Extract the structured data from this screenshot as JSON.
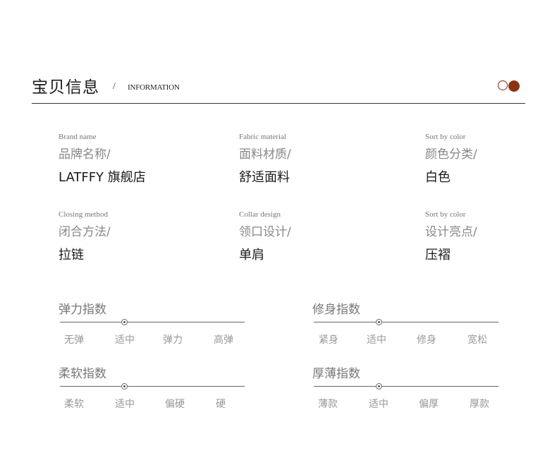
{
  "header": {
    "title_cn": "宝贝信息",
    "slash": "/",
    "title_en": "INFORMATION",
    "accent_color": "#8a3412"
  },
  "attributes": [
    {
      "en": "Brand name",
      "cn": "品牌名称/",
      "value": "LATFFY 旗舰店"
    },
    {
      "en": "Fabric material",
      "cn": "面料材质/",
      "value": "舒适面料"
    },
    {
      "en": "Sort by color",
      "cn": "颜色分类/",
      "value": "白色"
    },
    {
      "en": "Closing method",
      "cn": "闭合方法/",
      "value": "拉链"
    },
    {
      "en": "Collar design",
      "cn": "领口设计/",
      "value": "单肩"
    },
    {
      "en": "Sort by color",
      "cn": "设计亮点/",
      "value": "压褶"
    }
  ],
  "scales": [
    {
      "title": "弹力指数",
      "options": [
        "无弹",
        "适中",
        "弹力",
        "高弹"
      ],
      "selected_index": 1
    },
    {
      "title": "修身指数",
      "options": [
        "紧身",
        "适中",
        "修身",
        "宽松"
      ],
      "selected_index": 1
    },
    {
      "title": "柔软指数",
      "options": [
        "柔软",
        "适中",
        "偏硬",
        "硬"
      ],
      "selected_index": 1
    },
    {
      "title": "厚薄指数",
      "options": [
        "薄款",
        "适中",
        "偏厚",
        "厚款"
      ],
      "selected_index": 1
    }
  ]
}
